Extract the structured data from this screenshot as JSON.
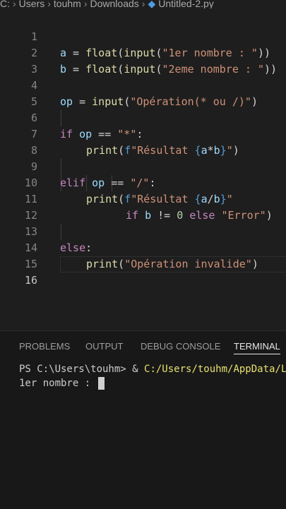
{
  "breadcrumb": {
    "drive": "C:",
    "items": [
      "Users",
      "touhm",
      "Downloads"
    ],
    "file": "Untitled-2.py"
  },
  "editor": {
    "lines": [
      {
        "n": "1"
      },
      {
        "n": "2"
      },
      {
        "n": "3"
      },
      {
        "n": "4"
      },
      {
        "n": "5"
      },
      {
        "n": "6"
      },
      {
        "n": "7"
      },
      {
        "n": "8"
      },
      {
        "n": "9"
      },
      {
        "n": "10"
      },
      {
        "n": "11"
      },
      {
        "n": "12"
      },
      {
        "n": "13"
      },
      {
        "n": "14"
      },
      {
        "n": "15"
      },
      {
        "n": "16"
      }
    ],
    "tokens": {
      "l1": [
        "a",
        " = ",
        "float",
        "(",
        "input",
        "(",
        "\"1er nombre : \"",
        "))"
      ],
      "l2": [
        "b",
        " = ",
        "float",
        "(",
        "input",
        "(",
        "\"2eme nombre : \"",
        "))"
      ],
      "l4": [
        "op",
        " = ",
        "input",
        "(",
        "\"Opération(* ou /)\"",
        ")"
      ],
      "l6": [
        "if",
        " ",
        "op",
        " == ",
        "\"*\"",
        ":"
      ],
      "l7": [
        "print",
        "(",
        "f",
        "\"Résultat ",
        "{",
        "a",
        "*",
        "b",
        "}",
        "\"",
        ")"
      ],
      "l9": [
        "elif",
        " ",
        "op",
        " == ",
        "\"/\"",
        ":"
      ],
      "l10": [
        "print",
        "(",
        "f",
        "\"Résultat ",
        "{",
        "a",
        "/",
        "b",
        "}",
        "\""
      ],
      "l11": [
        "if",
        " ",
        "b",
        " != ",
        "0",
        " ",
        "else",
        " ",
        "\"Error\"",
        ")"
      ],
      "l13": [
        "else",
        ":"
      ],
      "l14": [
        "print",
        "(",
        "\"Opération invalide\"",
        ")"
      ]
    }
  },
  "panel": {
    "tabs": [
      "PROBLEMS",
      "OUTPUT",
      "DEBUG CONSOLE",
      "TERMINAL"
    ],
    "terminal": {
      "prompt": "PS C:\\Users\\touhm> & ",
      "command": "C:/Users/touhm/AppData/L",
      "output": "1er nombre : "
    }
  }
}
